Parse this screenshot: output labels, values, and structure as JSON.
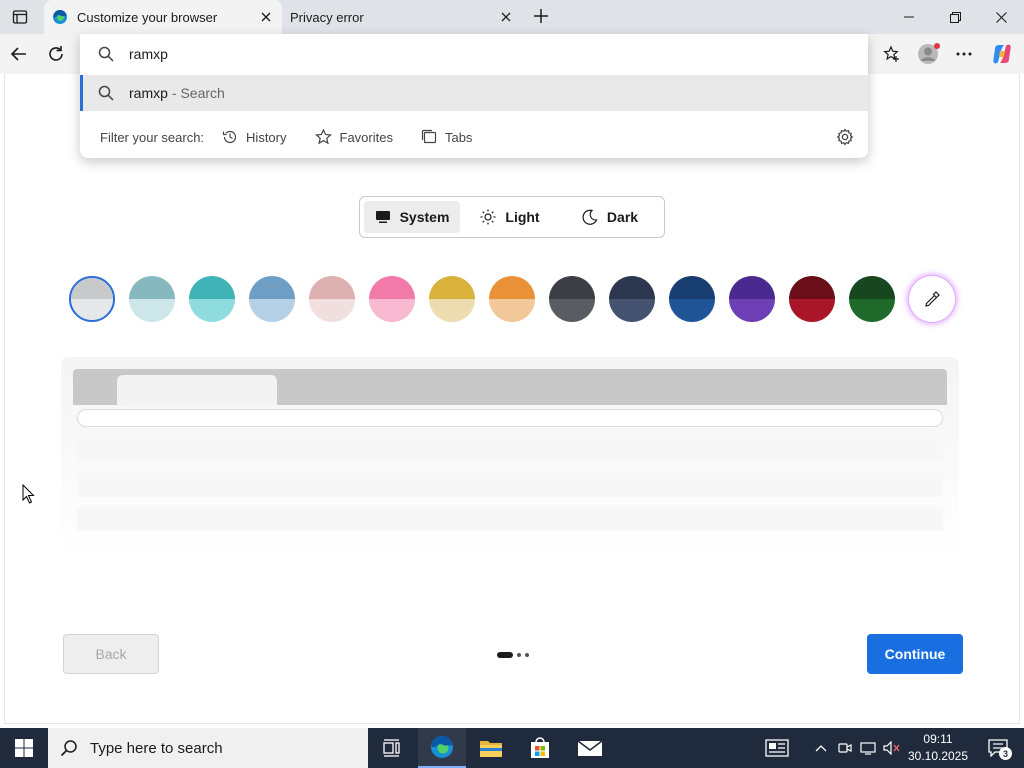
{
  "browser": {
    "tabs": [
      {
        "title": "Customize your browser",
        "active": true
      },
      {
        "title": "Privacy error",
        "active": false
      }
    ]
  },
  "omnibox": {
    "query": "ramxp",
    "suggestion": {
      "query": "ramxp",
      "suffix": "- Search"
    },
    "filter": {
      "label": "Filter your search:",
      "chips": [
        "History",
        "Favorites",
        "Tabs"
      ]
    }
  },
  "theme": {
    "options": [
      "System",
      "Light",
      "Dark"
    ],
    "selected": "System"
  },
  "swatches": [
    {
      "top": "#c8c9cb",
      "bottom": "#e6e7e9",
      "selected": true
    },
    {
      "top": "#86b9bf",
      "bottom": "#cde6e9"
    },
    {
      "top": "#3fb3b5",
      "bottom": "#8fdcdf"
    },
    {
      "top": "#6e9ec4",
      "bottom": "#b6d1e6"
    },
    {
      "top": "#dcb1b0",
      "bottom": "#f1dedf"
    },
    {
      "top": "#f17aa8",
      "bottom": "#f8b9d1"
    },
    {
      "top": "#d8b23c",
      "bottom": "#ecdcb0"
    },
    {
      "top": "#e99136",
      "bottom": "#f2c89b"
    },
    {
      "top": "#3c3e45",
      "bottom": "#5a5c63"
    },
    {
      "top": "#2b3850",
      "bottom": "#465370"
    },
    {
      "top": "#183d70",
      "bottom": "#1f5596"
    },
    {
      "top": "#4a2a8e",
      "bottom": "#6e3fb4"
    },
    {
      "top": "#6a0e1a",
      "bottom": "#a91628"
    },
    {
      "top": "#17461f",
      "bottom": "#1f6a2b"
    }
  ],
  "buttons": {
    "back": "Back",
    "continue": "Continue"
  },
  "taskbar": {
    "search_placeholder": "Type here to search",
    "time": "09:11",
    "date": "30.10.2025",
    "notification_count": "3"
  },
  "colors": {
    "accent": "#1a6fe0",
    "taskbar": "#1f2a3c"
  }
}
